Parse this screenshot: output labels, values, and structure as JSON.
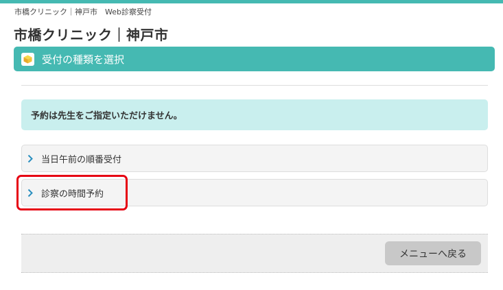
{
  "breadcrumb": "市橋クリニック｜神戸市　Web診察受付",
  "site_title": "市橋クリニック｜神戸市",
  "section": {
    "title": "受付の種類を選択",
    "icon": "cube-icon"
  },
  "notice": "予約は先生をご指定いただけません。",
  "options": [
    {
      "label": "当日午前の順番受付",
      "icon": "chevron-right-icon"
    },
    {
      "label": "診察の時間予約",
      "icon": "chevron-right-icon",
      "highlighted": true
    }
  ],
  "footer": {
    "back_label": "メニューへ戻る"
  },
  "colors": {
    "accent": "#45b9b2",
    "notice_bg": "#c9efee",
    "highlight": "#e60012",
    "chevron": "#2a8fbf"
  }
}
